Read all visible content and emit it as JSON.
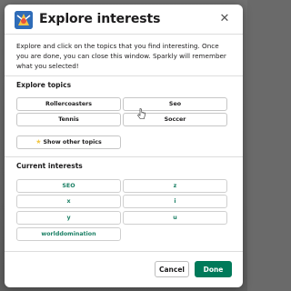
{
  "modal": {
    "title": "Explore interests",
    "description": "Explore and click on the topics that you find interesting. Once you are done, you can close this window. Sparkly will remember what you selected!",
    "close_icon": "close-icon"
  },
  "explore": {
    "label": "Explore topics",
    "topics": [
      "Rollercoasters",
      "Seo",
      "Tennis",
      "Soccer"
    ],
    "show_other_label": "Show other topics",
    "show_other_icon": "star-icon"
  },
  "interests": {
    "label": "Current interests",
    "items": [
      "SEO",
      "z",
      "x",
      "i",
      "y",
      "u",
      "worlddomination"
    ]
  },
  "footer": {
    "cancel_label": "Cancel",
    "done_label": "Done"
  },
  "colors": {
    "primary": "#007a5a",
    "interest_text": "#1a7f64",
    "star": "#f2c744"
  }
}
